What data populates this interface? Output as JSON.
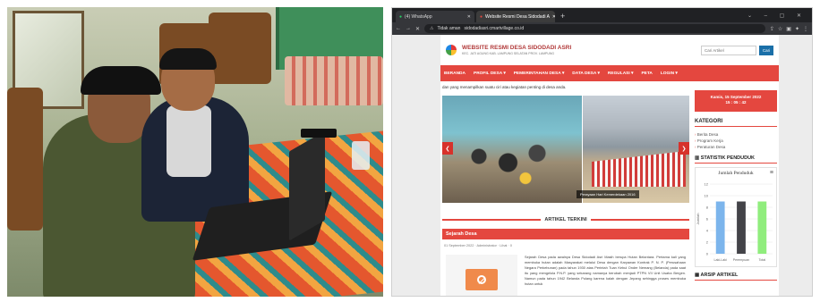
{
  "browser": {
    "tabs": [
      {
        "label": "(4) WhatsApp",
        "active": false
      },
      {
        "label": "Website Resmi Desa Sidodadi A",
        "active": true
      }
    ],
    "url_warning": "Tidak aman",
    "url": "sidodadiasri.cmartvillage.co.id"
  },
  "site": {
    "title": "WEBSITE RESMI DESA SIDODADI ASRI",
    "subtitle": "KEC. JATI AGUNG KAB. LAMPUNG SELATAN PROV. LAMPUNG",
    "search_placeholder": "Cari Artikel",
    "search_button": "Cari",
    "nav": [
      "BERANDA",
      "PROFIL DESA ▾",
      "PEMERINTAHAN DESA ▾",
      "DATA DESA ▾",
      "REGULASI ▾",
      "PETA",
      "LOGIN ▾"
    ],
    "marquee": "dan yang menampilkan suatu ciri atau kegiatan penting di desa anda.",
    "slide_caption": "Perayaan Hari Kemerdekaan 2016",
    "artikel_heading": "ARTIKEL TERKINI",
    "article_title": "Sejarah Desa",
    "article_meta": "01 September 2022  ·  Administrator  ·  Lihat  ·  0",
    "article_text": "Sejarah Desa pada awalnya Desa Sidodadi Asri Masih berupa Hutan Belantara. Pertama kali yang membuka hutan adalah Masyarakat melalui Desa dengan Karyawan Kontrak P. N. P. (Perusahaan Negara Perkebunan) pada tahun 1930 atas Perintah Tuan Kebul Onder Nemang (Belanda) pada saat itu yang mengelola P.N.P. yang sekarang namanya berubah menjadi PTPN VII Unit Usaha Bergen. Namun pada tahun 1942 Belanda Pulang karena kalah dengan Jepang sehingga proses membuka hutan untuk"
  },
  "sidebar": {
    "date": "Kamis, 15 September 2022",
    "time": "15 : 05 : 42",
    "kategori_title": "KATEGORI",
    "kategori": [
      "Berita Desa",
      "Program Kerja",
      "Peraturan Desa"
    ],
    "statistik_title": "STATISTIK PENDUDUK",
    "arsip_title": "ARSIP ARTIKEL"
  },
  "chart_data": {
    "type": "bar",
    "title": "Jumlah Penduduk",
    "ylabel": "Jumlah",
    "categories": [
      "Laki-Laki",
      "Perempuan",
      "Total"
    ],
    "values": [
      9,
      9,
      9
    ],
    "ylim": [
      0,
      12
    ],
    "yticks": [
      0,
      2,
      4,
      6,
      8,
      10,
      12
    ],
    "colors": [
      "#7cb5ec",
      "#434348",
      "#90ed7d"
    ]
  },
  "colors": {
    "brand_red": "#e4473f",
    "button_blue": "#1a6fa8"
  }
}
